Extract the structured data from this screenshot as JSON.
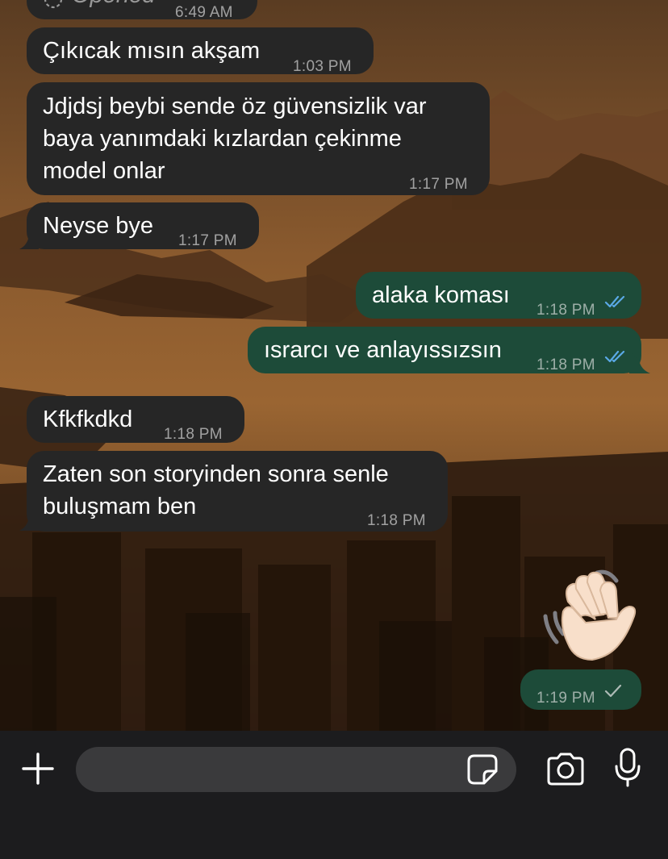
{
  "colors": {
    "incoming_bubble": "#262626",
    "outgoing_bubble": "#1d4b39",
    "read_ticks": "#5aa9e6",
    "composer_bg": "#1c1c1e",
    "input_bg": "#3a3a3c"
  },
  "messages": [
    {
      "direction": "incoming",
      "text": "Opened",
      "time": "6:49 AM"
    },
    {
      "direction": "incoming",
      "text": "Çıkıcak mısın akşam",
      "time": "1:03 PM"
    },
    {
      "direction": "incoming",
      "text": "Jdjdsj beybi sende öz güvensizlik var\nbaya yanımdaki kızlardan çekinme\nmodel onlar",
      "time": "1:17 PM"
    },
    {
      "direction": "incoming",
      "text": "Neyse bye",
      "time": "1:17 PM"
    },
    {
      "direction": "outgoing",
      "text": "alaka koması",
      "time": "1:18 PM",
      "status": "read"
    },
    {
      "direction": "outgoing",
      "text": "ısrarcı ve anlayıssızsın",
      "time": "1:18 PM",
      "status": "read"
    },
    {
      "direction": "incoming",
      "text": "Kfkfkdkd",
      "time": "1:18 PM"
    },
    {
      "direction": "incoming",
      "text": "Zaten son storyinden sonra senle\nbuluşmam ben",
      "time": "1:18 PM"
    },
    {
      "direction": "outgoing",
      "type": "sticker",
      "sticker": "waving-hand-emoji",
      "time": "1:19 PM",
      "status": "sent"
    }
  ],
  "composer": {
    "plus_icon": "plus-icon",
    "sticker_icon": "sticker-icon",
    "camera_icon": "camera-icon",
    "mic_icon": "microphone-icon",
    "input_value": ""
  }
}
